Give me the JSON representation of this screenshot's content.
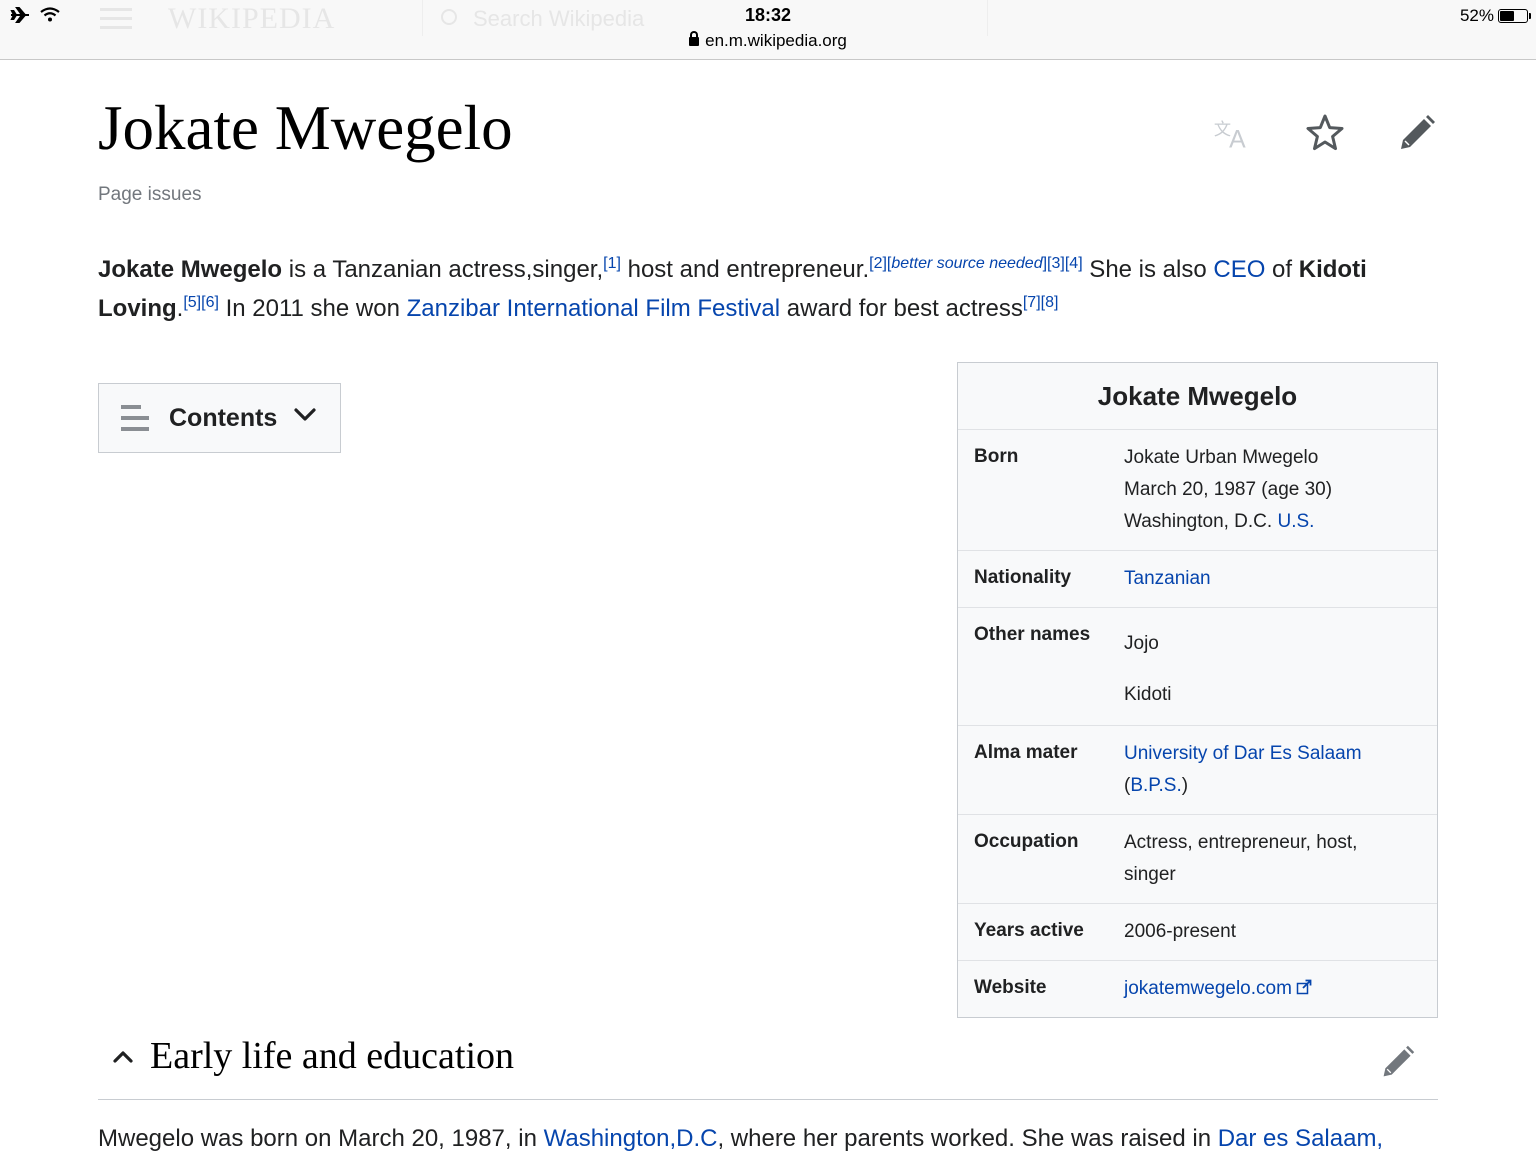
{
  "status_bar": {
    "time": "18:32",
    "url": "en.m.wikipedia.org",
    "battery": "52%",
    "battery_level": 0.52
  },
  "background_header": {
    "logo": "WIKIPEDIA",
    "search_placeholder": "Search Wikipedia"
  },
  "page": {
    "title": "Jokate Mwegelo",
    "page_issues": "Page issues"
  },
  "page_actions": {
    "language_icon": "language-icon",
    "watch_icon": "star-icon",
    "edit_icon": "pencil-icon"
  },
  "intro": {
    "s1_bold": "Jokate Mwegelo",
    "s1_text": " is a Tanzanian actress,singer,",
    "ref1": "[1]",
    "s2_text": " host and entrepreneur.",
    "ref2": "[2]",
    "ref_bsn_open": "[",
    "ref_bsn": "better source needed",
    "ref_bsn_close": "]",
    "ref3": "[3]",
    "ref4": "[4]",
    "s3_text": " She is also ",
    "ceo_link": "CEO",
    "s3_of": " of ",
    "kidoti_bold": "Kidoti Loving",
    "s3_end": ".",
    "ref5": "[5]",
    "ref6": "[6]",
    "s4_text": " In 2011 she won ",
    "ziff_link": "Zanzibar International Film Festival",
    "s4_end": " award for best actress",
    "ref7": "[7]",
    "ref8": "[8]"
  },
  "toc": {
    "label": "Contents"
  },
  "infobox": {
    "title": "Jokate Mwegelo",
    "born_label": "Born",
    "born_name": "Jokate Urban Mwegelo",
    "born_date": "March 20, 1987 (age 30)",
    "born_place": "Washington, D.C. ",
    "born_place_link": "U.S.",
    "nationality_label": "Nationality",
    "nationality": "Tanzanian",
    "other_names_label": "Other names",
    "other_name_1": "Jojo",
    "other_name_2": "Kidoti",
    "alma_label": "Alma mater",
    "alma_link": "University of Dar Es Salaam",
    "alma_open": "(",
    "alma_degree": "B.P.S.",
    "alma_close": ")",
    "occupation_label": "Occupation",
    "occupation_1": "Actress, entrepreneur, host,",
    "occupation_2": "singer",
    "years_label": "Years active",
    "years": "2006-present",
    "website_label": "Website",
    "website": "jokatemwegelo.com"
  },
  "section": {
    "title": "Early life and education",
    "text_start": "Mwegelo was born on March 20, 1987, in ",
    "dc_link": "Washington,D.C",
    "text_mid": ", where her parents worked. She was raised in ",
    "dar_link": "Dar es Salaam,"
  }
}
